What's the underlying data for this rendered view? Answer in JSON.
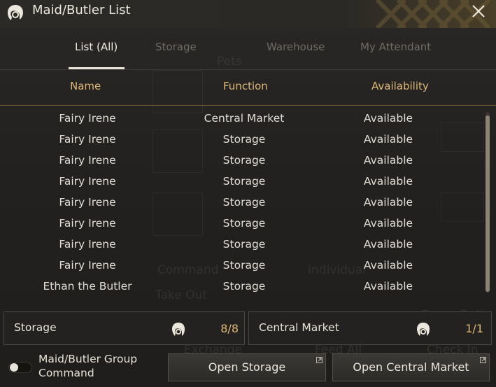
{
  "window": {
    "title": "Maid/Butler List",
    "title_icon": "maid-head-icon",
    "close_icon": "close-icon"
  },
  "tabs": [
    {
      "label": "List (All)",
      "active": true
    },
    {
      "label": "Storage",
      "active": false
    },
    {
      "label": "Warehouse",
      "active": false
    },
    {
      "label": "My Attendant",
      "active": false
    }
  ],
  "table": {
    "headers": [
      "Name",
      "Function",
      "Availability"
    ],
    "rows": [
      {
        "name": "Fairy Irene",
        "function": "Central Market",
        "availability": "Available"
      },
      {
        "name": "Fairy Irene",
        "function": "Storage",
        "availability": "Available"
      },
      {
        "name": "Fairy Irene",
        "function": "Storage",
        "availability": "Available"
      },
      {
        "name": "Fairy Irene",
        "function": "Storage",
        "availability": "Available"
      },
      {
        "name": "Fairy Irene",
        "function": "Storage",
        "availability": "Available"
      },
      {
        "name": "Fairy Irene",
        "function": "Storage",
        "availability": "Available"
      },
      {
        "name": "Fairy Irene",
        "function": "Storage",
        "availability": "Available"
      },
      {
        "name": "Fairy Irene",
        "function": "Storage",
        "availability": "Available"
      },
      {
        "name": "Ethan the Butler",
        "function": "Storage",
        "availability": "Available"
      }
    ]
  },
  "summary": {
    "storage": {
      "label": "Storage",
      "count": "8/8"
    },
    "market": {
      "label": "Central Market",
      "count": "1/1"
    }
  },
  "group_command": {
    "label": "Maid/Butler Group Command",
    "enabled": false
  },
  "buttons": {
    "open_storage": "Open Storage",
    "open_market": "Open Central Market"
  },
  "background_ghost_text": {
    "pets": "Pets",
    "command": "Command",
    "individual": "Individual",
    "take_out": "Take Out",
    "exchange": "Exchange",
    "feed_all": "Feed All",
    "check_in_all": "Check In All",
    "game_option": "Game Optio"
  },
  "colors": {
    "accent_gold": "#e0b878",
    "text_primary": "#e2ddd4",
    "tab_inactive": "#6f6a62",
    "background": "#232120"
  }
}
